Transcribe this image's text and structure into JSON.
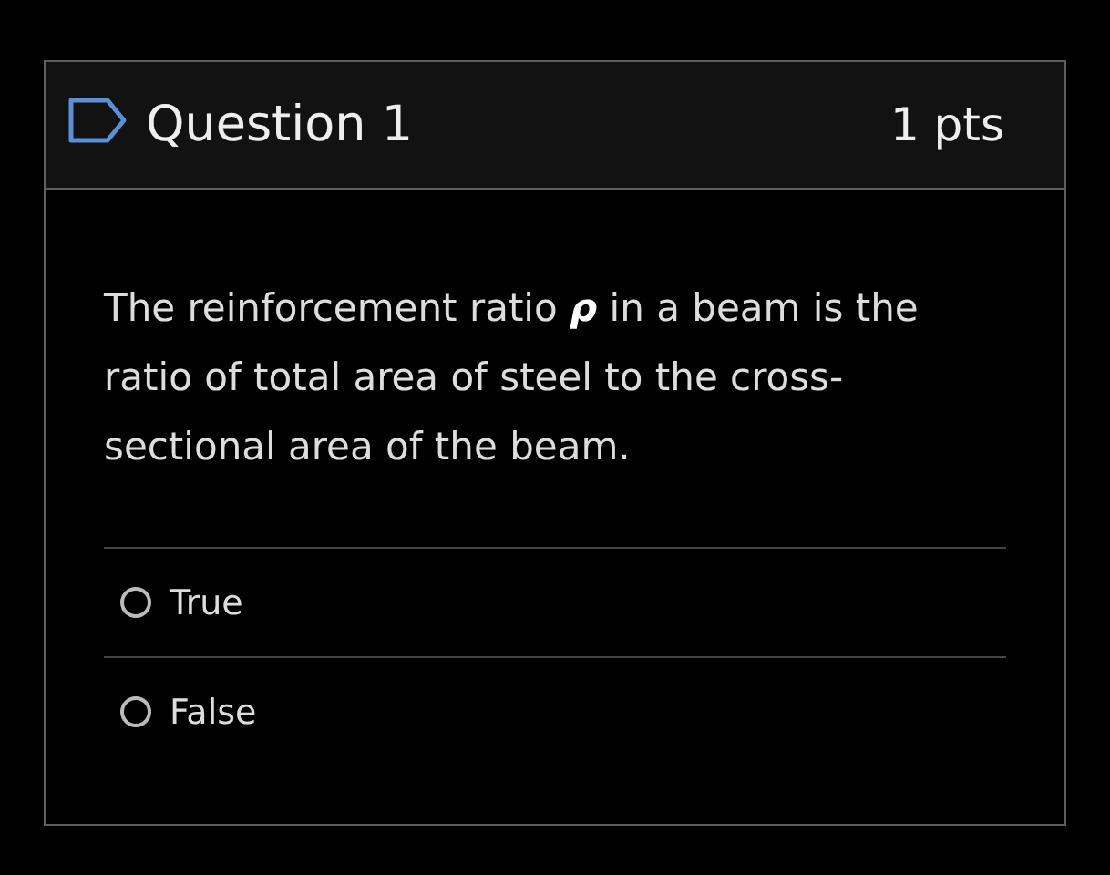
{
  "question": {
    "title": "Question 1",
    "points": "1 pts",
    "text": "The reinforcement ratio **ρ** in a beam is the ratio of total area of steel to the cross-sectional area of the beam."
  },
  "options": [
    {
      "label": "True",
      "selected": false
    },
    {
      "label": "False",
      "selected": false
    }
  ]
}
